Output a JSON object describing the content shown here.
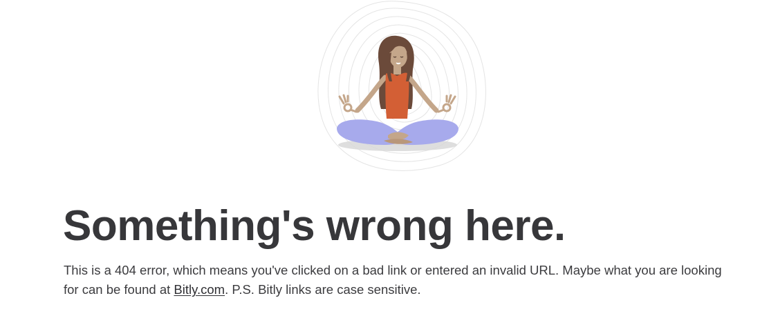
{
  "illustration": {
    "icon": "meditating-woman-illustration",
    "colors": {
      "hair": "#6b4a3a",
      "skin": "#c4a68a",
      "top": "#d35f35",
      "pants": "#a7aaec",
      "shadow": "#d8d8d8",
      "rings": "#e4e4e4"
    }
  },
  "headline": "Something's wrong here.",
  "message": {
    "part1": "This is a 404 error, which means you've clicked on a bad link or entered an invalid URL. Maybe what you are looking for can be found at ",
    "link_text": "Bitly.com",
    "part2": ". P.S. Bitly links are case sensitive."
  }
}
